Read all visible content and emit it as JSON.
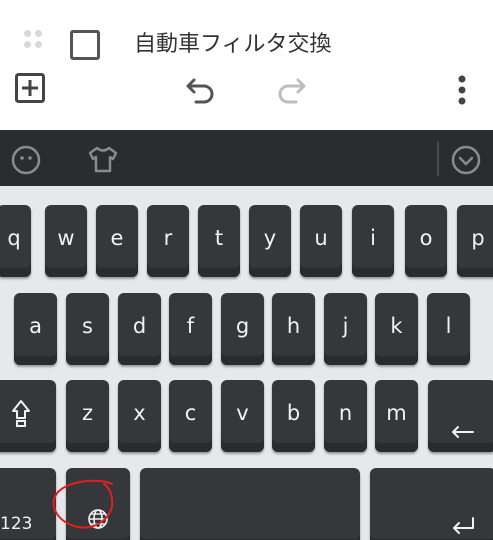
{
  "list": {
    "item_text": "自動車フィルタ交換"
  },
  "toolbar": {
    "add_icon": "plus-square-icon",
    "undo_icon": "undo-icon",
    "redo_icon": "redo-icon",
    "more_icon": "more-vertical-icon"
  },
  "keyboard": {
    "topbar": {
      "emoji_icon": "emoji-icon",
      "theme_icon": "shirt-icon",
      "collapse_icon": "chevron-down-circle-icon"
    },
    "row1": [
      "q",
      "w",
      "e",
      "r",
      "t",
      "y",
      "u",
      "i",
      "o",
      "p"
    ],
    "row2": [
      "a",
      "s",
      "d",
      "f",
      "g",
      "h",
      "j",
      "k",
      "l"
    ],
    "row3": [
      "z",
      "x",
      "c",
      "v",
      "b",
      "n",
      "m"
    ],
    "shift_icon": "shift-icon",
    "backspace_icon": "backspace-icon",
    "numbers_label": "123",
    "globe_icon": "globe-icon",
    "enter_icon": "enter-icon"
  },
  "colors": {
    "keyboard_bg": "#e7e8ec",
    "key_bg": "#36373b",
    "key_text": "#f2f2f2",
    "topbar_bg": "#2b2c30",
    "annotation": "#e02020"
  }
}
